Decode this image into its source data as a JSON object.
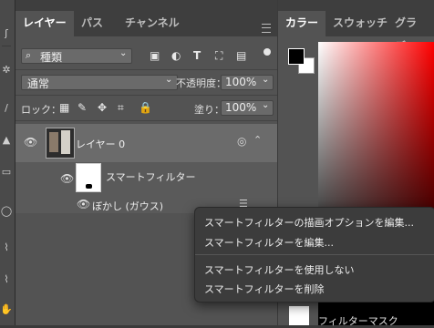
{
  "layers_panel": {
    "tabs": [
      {
        "label": "レイヤー",
        "active": true
      },
      {
        "label": "パス",
        "active": false
      },
      {
        "label": "チャンネル",
        "active": false
      }
    ],
    "filter_kind": "種類",
    "blend_mode": "通常",
    "opacity_label": "不透明度：",
    "opacity_value": "100%",
    "lock_label": "ロック：",
    "fill_label": "塗り：",
    "fill_value": "100%",
    "layer0_name": "レイヤー 0",
    "smart_filter_label": "スマートフィルター",
    "filter_name": "ぼかし (ガウス)"
  },
  "color_panel": {
    "tabs": [
      {
        "label": "カラー",
        "active": true
      },
      {
        "label": "スウォッチ",
        "active": false
      },
      {
        "label": "グラデー",
        "active": false
      }
    ],
    "filter_mask_label": "フィルターマスク",
    "hue_color": "#ff0000"
  },
  "context_menu": {
    "items": [
      "スマートフィルターの描画オプションを編集...",
      "スマートフィルターを編集...",
      "スマートフィルターを使用しない",
      "スマートフィルターを削除"
    ]
  }
}
